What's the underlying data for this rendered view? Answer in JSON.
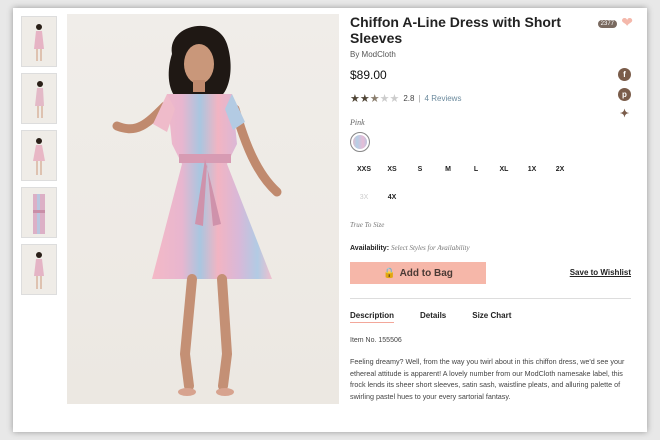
{
  "product": {
    "title": "Chiffon A-Line Dress with Short Sleeves",
    "brand": "By ModCloth",
    "price": "$89.00",
    "likes": "2377",
    "rating": 2.8,
    "rating_text": "2.8",
    "reviews_link": "4 Reviews",
    "color_label": "Pink",
    "sizes": [
      "XXS",
      "XS",
      "S",
      "M",
      "L",
      "XL",
      "1X",
      "2X",
      "3X",
      "4X"
    ],
    "unavailable_sizes": [
      "3X"
    ],
    "fit_note": "True To Size",
    "availability_label": "Availability:",
    "availability_value": "Select Styles for Availability",
    "add_to_bag": "Add to Bag",
    "save_to_wishlist": "Save to Wishlist",
    "tabs": [
      "Description",
      "Details",
      "Size Chart"
    ],
    "item_number": "Item No. 155506",
    "description": "Feeling dreamy? Well, from the way you twirl about in this chiffon dress, we'd see your ethereal attitude is apparent! A lovely number from our ModCloth namesake label, this frock lends its sheer short sleeves, satin sash, waistline pleats, and alluring palette of swirling pastel hues to your every sartorial fantasy."
  },
  "social_icons": [
    "facebook-icon",
    "pinterest-icon",
    "twitter-icon"
  ],
  "colors": {
    "accent": "#f6b7a9",
    "star": "#4f4536",
    "link": "#6b8a9d"
  }
}
